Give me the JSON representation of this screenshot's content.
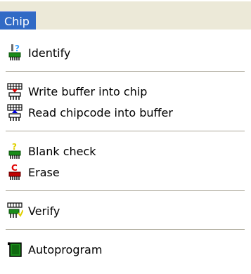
{
  "menubar": {
    "title": "Chip"
  },
  "menu": {
    "items": [
      {
        "label": "Identify",
        "icon": "identify-chip-icon"
      },
      {
        "label": "Write buffer into chip",
        "icon": "write-chip-icon"
      },
      {
        "label": "Read chipcode into buffer",
        "icon": "read-chip-icon"
      },
      {
        "label": "Blank check",
        "icon": "blank-check-chip-icon"
      },
      {
        "label": "Erase",
        "icon": "erase-chip-icon"
      },
      {
        "label": "Verify",
        "icon": "verify-chip-icon"
      },
      {
        "label": "Autoprogram",
        "icon": "autoprogram-chip-icon"
      }
    ]
  },
  "colors": {
    "highlight": "#316ac5",
    "menubar_bg": "#ece9d8",
    "separator": "#aca899"
  }
}
